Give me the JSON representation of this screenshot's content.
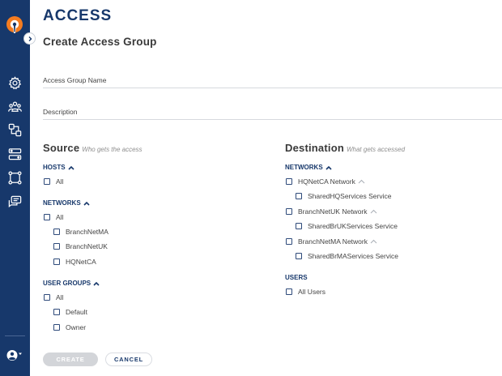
{
  "page": {
    "title": "ACCESS",
    "subtitle": "Create Access Group"
  },
  "form": {
    "name_placeholder": "Access Group Name",
    "description_placeholder": "Description"
  },
  "source": {
    "heading": "Source",
    "hint": "Who gets the access",
    "hosts": {
      "label": "HOSTS",
      "all": "All"
    },
    "networks": {
      "label": "NETWORKS",
      "all": "All",
      "items": [
        "BranchNetMA",
        "BranchNetUK",
        "HQNetCA"
      ]
    },
    "user_groups": {
      "label": "USER GROUPS",
      "all": "All",
      "items": [
        "Default",
        "Owner"
      ]
    }
  },
  "destination": {
    "heading": "Destination",
    "hint": "What gets accessed",
    "networks": {
      "label": "NETWORKS",
      "items": [
        {
          "network": "HQNetCA Network",
          "service": "SharedHQServices Service"
        },
        {
          "network": "BranchNetUK Network",
          "service": "SharedBrUKServices Service"
        },
        {
          "network": "BranchNetMA Network",
          "service": "SharedBrMAServices Service"
        }
      ]
    },
    "users": {
      "label": "USERS",
      "all": "All Users"
    }
  },
  "actions": {
    "create": "CREATE",
    "cancel": "CANCEL"
  },
  "colors": {
    "sidebar": "#17386b",
    "accent": "#17386b",
    "logo_orange": "#f57c20"
  },
  "sidebar_icons": [
    "settings-icon",
    "users-icon",
    "access-groups-icon",
    "services-icon",
    "network-icon",
    "messages-icon",
    "account-icon"
  ]
}
